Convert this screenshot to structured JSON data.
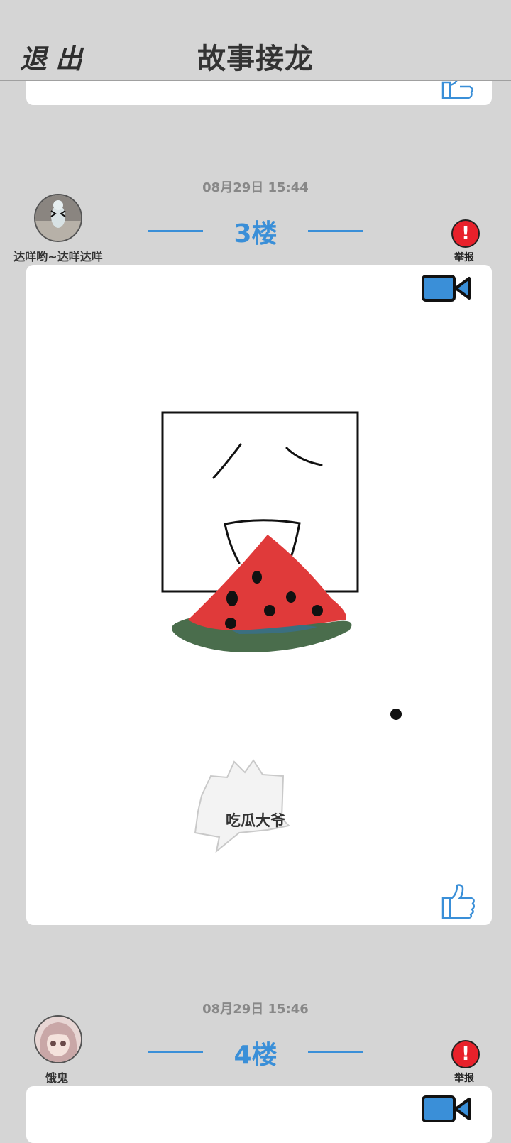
{
  "header": {
    "exit_label": "退出",
    "title": "故事接龙"
  },
  "posts": [
    {
      "timestamp": "08月29日  15:44",
      "username": "达咩哟~达咩达咩",
      "floor": "3楼",
      "report_label": "举报",
      "caption": "吃瓜大爷"
    },
    {
      "timestamp": "08月29日  15:46",
      "username": "饿鬼",
      "floor": "4楼",
      "report_label": "举报"
    }
  ],
  "colors": {
    "accent_blue": "#3a8fd8",
    "report_red": "#e8212b",
    "background": "#d5d5d5"
  },
  "icons": [
    "video-camera-icon",
    "thumbs-up-icon",
    "alert-icon"
  ]
}
